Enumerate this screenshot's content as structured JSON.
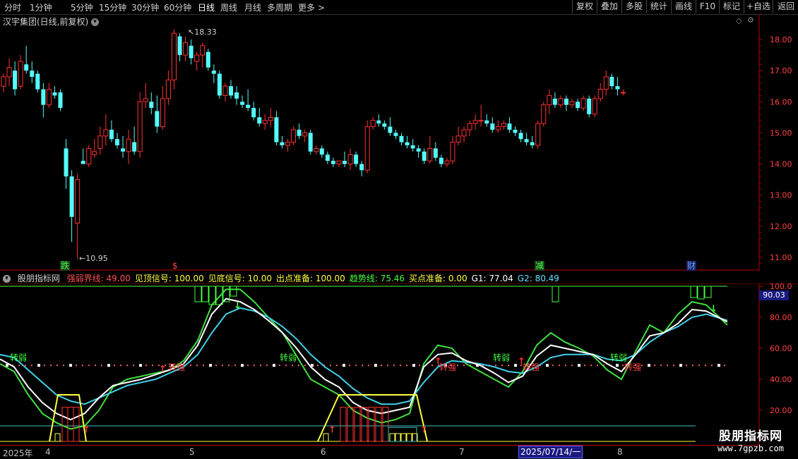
{
  "topbar": {
    "periods": [
      "分时",
      "1分钟",
      "5分钟",
      "15分钟",
      "30分钟",
      "60分钟",
      "日线",
      "周线",
      "月线",
      "多周期",
      "更多 >"
    ],
    "right_buttons": [
      "复权",
      "叠加",
      "多股",
      "统计",
      "画线",
      "F10",
      "标记",
      "+自选",
      "返回"
    ]
  },
  "main_chart": {
    "title": "汉宇集团(日线,前复权)",
    "high_label": "18.33",
    "low_label": "10.95",
    "y_ticks": [
      "18.00",
      "17.00",
      "16.00",
      "15.00",
      "14.00",
      "13.00",
      "12.00",
      "11.00"
    ],
    "markers": [
      "跌",
      "$",
      "减",
      "财"
    ]
  },
  "indicator": {
    "name": "股朋指标网",
    "params": [
      {
        "label": "强弱界线:",
        "value": "49.00",
        "color": "#ff5050"
      },
      {
        "label": "见顶信号:",
        "value": "100.00",
        "color": "#ffff40"
      },
      {
        "label": "见底信号:",
        "value": "10.00",
        "color": "#ffff40"
      },
      {
        "label": "出点准备:",
        "value": "100.00",
        "color": "#ffff40"
      },
      {
        "label": "趋势线:",
        "value": "75.46",
        "color": "#40ff40"
      },
      {
        "label": "买点准备:",
        "value": "0.00",
        "color": "#ffff40"
      },
      {
        "label": "G1:",
        "value": "77.04",
        "color": "#ffffff"
      },
      {
        "label": "G2:",
        "value": "80.49",
        "color": "#60e0ff"
      }
    ],
    "y_ticks": [
      "100.0",
      "80.00",
      "60.00",
      "40.00",
      "20.00"
    ],
    "current_value": "90.03",
    "text_labels": [
      "转弱",
      "转强",
      "转弱",
      "转强",
      "转弱",
      "转强",
      "转弱",
      "转强"
    ]
  },
  "date_axis": {
    "labels": [
      "2025年",
      "4",
      "5",
      "6",
      "7",
      "8"
    ],
    "highlight": "2025/07/14/一"
  },
  "watermark": {
    "line1": "股朋指标网",
    "line2": "www.7gpzb.com"
  },
  "colors": {
    "up": "#ff3030",
    "down": "#54fcfc",
    "grid": "#b00000"
  }
}
